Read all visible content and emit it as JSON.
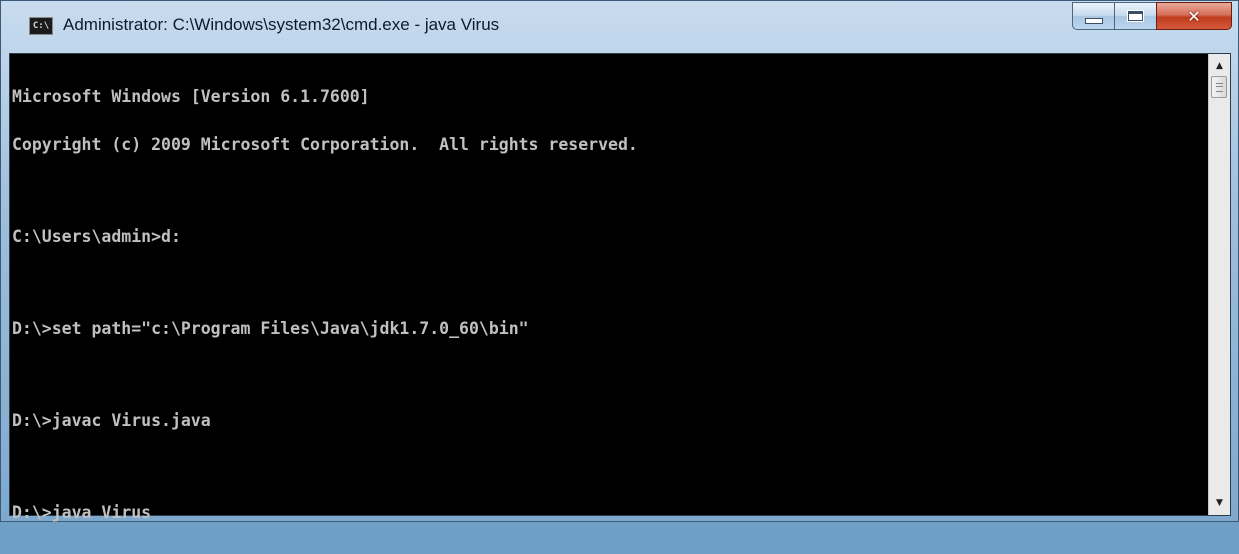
{
  "window": {
    "title": "Administrator: C:\\Windows\\system32\\cmd.exe - java  Virus",
    "icon_text": "C:\\",
    "icon": "cmd-console-icon",
    "colors": {
      "console_bg": "#000000",
      "console_fg": "#c0c0c0",
      "close_button": "#c23c1e"
    }
  },
  "caption_buttons": {
    "minimize_icon": "minimize-icon",
    "maximize_icon": "maximize-icon",
    "close_glyph": "✕"
  },
  "console": {
    "lines": [
      "Microsoft Windows [Version 6.1.7600]",
      "Copyright (c) 2009 Microsoft Corporation.  All rights reserved.",
      "",
      "C:\\Users\\admin>d:",
      "",
      "D:\\>set path=\"c:\\Program Files\\Java\\jdk1.7.0_60\\bin\"",
      "",
      "D:\\>javac Virus.java",
      "",
      "D:\\>java Virus"
    ]
  },
  "scrollbar": {
    "up_arrow": "▲",
    "down_arrow": "▼"
  }
}
